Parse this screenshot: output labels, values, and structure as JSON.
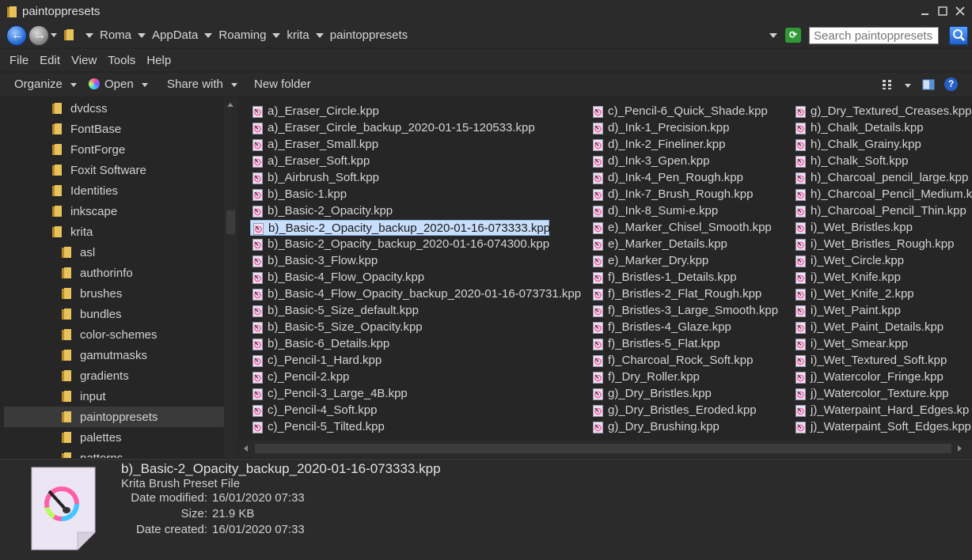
{
  "window": {
    "title": "paintoppresets"
  },
  "address": {
    "crumbs": [
      "Roma",
      "AppData",
      "Roaming",
      "krita",
      "paintoppresets"
    ],
    "search_placeholder": "Search paintoppresets"
  },
  "menu": [
    "File",
    "Edit",
    "View",
    "Tools",
    "Help"
  ],
  "toolbar": {
    "organize": "Organize",
    "open": "Open",
    "share": "Share with",
    "new_folder": "New folder"
  },
  "nav": [
    {
      "label": "dvdcss",
      "level": 1
    },
    {
      "label": "FontBase",
      "level": 1
    },
    {
      "label": "FontForge",
      "level": 1
    },
    {
      "label": "Foxit Software",
      "level": 1
    },
    {
      "label": "Identities",
      "level": 1
    },
    {
      "label": "inkscape",
      "level": 1
    },
    {
      "label": "krita",
      "level": 1
    },
    {
      "label": "asl",
      "level": 2
    },
    {
      "label": "authorinfo",
      "level": 2
    },
    {
      "label": "brushes",
      "level": 2
    },
    {
      "label": "bundles",
      "level": 2
    },
    {
      "label": "color-schemes",
      "level": 2
    },
    {
      "label": "gamutmasks",
      "level": 2
    },
    {
      "label": "gradients",
      "level": 2
    },
    {
      "label": "input",
      "level": 2
    },
    {
      "label": "paintoppresets",
      "level": 2,
      "selected": true
    },
    {
      "label": "palettes",
      "level": 2
    },
    {
      "label": "patterns",
      "level": 2
    }
  ],
  "files": {
    "col1": [
      "a)_Eraser_Circle.kpp",
      "a)_Eraser_Circle_backup_2020-01-15-120533.kpp",
      "a)_Eraser_Small.kpp",
      "a)_Eraser_Soft.kpp",
      "b)_Airbrush_Soft.kpp",
      "b)_Basic-1.kpp",
      "b)_Basic-2_Opacity.kpp",
      "b)_Basic-2_Opacity_backup_2020-01-16-073333.kpp",
      "b)_Basic-2_Opacity_backup_2020-01-16-074300.kpp",
      "b)_Basic-3_Flow.kpp",
      "b)_Basic-4_Flow_Opacity.kpp",
      "b)_Basic-4_Flow_Opacity_backup_2020-01-16-073731.kpp",
      "b)_Basic-5_Size_default.kpp",
      "b)_Basic-5_Size_Opacity.kpp",
      "b)_Basic-6_Details.kpp",
      "c)_Pencil-1_Hard.kpp",
      "c)_Pencil-2.kpp",
      "c)_Pencil-3_Large_4B.kpp",
      "c)_Pencil-4_Soft.kpp",
      "c)_Pencil-5_Tilted.kpp"
    ],
    "col2": [
      "c)_Pencil-6_Quick_Shade.kpp",
      "d)_Ink-1_Precision.kpp",
      "d)_Ink-2_Fineliner.kpp",
      "d)_Ink-3_Gpen.kpp",
      "d)_Ink-4_Pen_Rough.kpp",
      "d)_Ink-7_Brush_Rough.kpp",
      "d)_Ink-8_Sumi-e.kpp",
      "e)_Marker_Chisel_Smooth.kpp",
      "e)_Marker_Details.kpp",
      "e)_Marker_Dry.kpp",
      "f)_Bristles-1_Details.kpp",
      "f)_Bristles-2_Flat_Rough.kpp",
      "f)_Bristles-3_Large_Smooth.kpp",
      "f)_Bristles-4_Glaze.kpp",
      "f)_Bristles-5_Flat.kpp",
      "f)_Charcoal_Rock_Soft.kpp",
      "f)_Dry_Roller.kpp",
      "g)_Dry_Bristles.kpp",
      "g)_Dry_Bristles_Eroded.kpp",
      "g)_Dry_Brushing.kpp"
    ],
    "col3": [
      "g)_Dry_Textured_Creases.kpp",
      "h)_Chalk_Details.kpp",
      "h)_Chalk_Grainy.kpp",
      "h)_Chalk_Soft.kpp",
      "h)_Charcoal_pencil_large.kpp",
      "h)_Charcoal_Pencil_Medium.k",
      "h)_Charcoal_Pencil_Thin.kpp",
      "i)_Wet_Bristles.kpp",
      "i)_Wet_Bristles_Rough.kpp",
      "i)_Wet_Circle.kpp",
      "i)_Wet_Knife.kpp",
      "i)_Wet_Knife_2.kpp",
      "i)_Wet_Paint.kpp",
      "i)_Wet_Paint_Details.kpp",
      "i)_Wet_Smear.kpp",
      "i)_Wet_Textured_Soft.kpp",
      "j)_Watercolor_Fringe.kpp",
      "j)_Watercolor_Texture.kpp",
      "j)_Waterpaint_Hard_Edges.kp",
      "j)_Waterpaint_Soft_Edges.kpp"
    ],
    "selected": "b)_Basic-2_Opacity_backup_2020-01-16-073333.kpp"
  },
  "details": {
    "name": "b)_Basic-2_Opacity_backup_2020-01-16-073333.kpp",
    "type": "Krita Brush Preset File",
    "rows": [
      {
        "key": "Date modified:",
        "value": "16/01/2020 07:33"
      },
      {
        "key": "Size:",
        "value": "21.9 KB"
      },
      {
        "key": "Date created:",
        "value": "16/01/2020 07:33"
      }
    ]
  },
  "colors": {
    "background": "#262626",
    "selection": "#c8defa",
    "folder": "#e8c25a",
    "accent": "#2a6fd4"
  }
}
